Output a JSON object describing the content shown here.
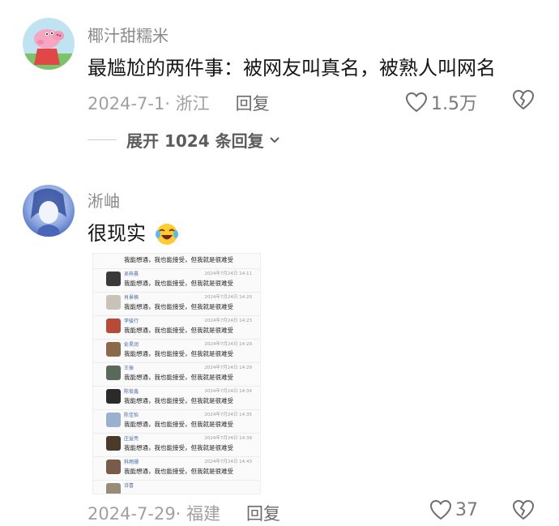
{
  "comment1": {
    "username": "椰汁甜糯米",
    "text": "最尴尬的两件事：被网友叫真名，被熟人叫网名",
    "date_location": "2024-7-1· 浙江",
    "reply_label": "回复",
    "likes": "1.5万",
    "expand_label": "展开 1024 条回复"
  },
  "comment2": {
    "username": "淅岫",
    "text": "很现实",
    "date_location": "2024-7-29· 福建",
    "reply_label": "回复",
    "likes": "37",
    "attachment": {
      "top_msg": "我能想通，我也能接受，但我就是很难受",
      "rows": [
        {
          "name": "吴梓晨",
          "date": "2024年7月24日 14:11",
          "msg": "我能想通，我也能接受，但我就是很难受",
          "color": "#3a3a3a"
        },
        {
          "name": "肖景楠",
          "date": "2024年7月24日 14:20",
          "msg": "我能想通，我也能接受，但我就是很难受",
          "color": "#c9c2b8"
        },
        {
          "name": "李骏行",
          "date": "2024年7月24日 14:23",
          "msg": "我能想通，我也能接受，但我就是很难受",
          "color": "#b84a3a"
        },
        {
          "name": "俞昊润",
          "date": "2024年7月24日 14:29",
          "msg": "我能想通，我也能接受，但我就是很难受",
          "color": "#8a6a4a"
        },
        {
          "name": "王振",
          "date": "2024年7月24日 14:29",
          "msg": "我能想通，我也能接受，但我就是很难受",
          "color": "#5a6a5a"
        },
        {
          "name": "陈俊鑫",
          "date": "2024年7月24日 14:34",
          "msg": "我能想通，我也能接受，但我就是很难受",
          "color": "#2a2a2a"
        },
        {
          "name": "陈佳怡",
          "date": "2024年7月24日 14:35",
          "msg": "我能想通，我也能接受，但我就是很难受",
          "color": "#9ab0d0"
        },
        {
          "name": "庄益亮",
          "date": "2024年7月24日 14:39",
          "msg": "我能想通，我也能接受，但我就是很难受",
          "color": "#4a3a2a"
        },
        {
          "name": "科雨珊",
          "date": "2024年7月24日 14:43",
          "msg": "我能想通，我也能接受，但我就是很难受",
          "color": "#7a5a4a"
        },
        {
          "name": "诗喜",
          "date": "",
          "msg": "",
          "color": "#9a8a7a"
        }
      ]
    }
  },
  "colors": {
    "username": "#8a8a8a",
    "text": "#161616",
    "meta": "#a0a0a0"
  }
}
